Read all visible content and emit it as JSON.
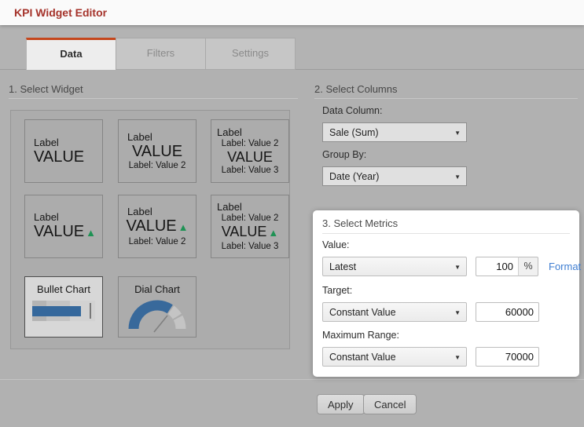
{
  "window": {
    "title": "KPI Widget Editor"
  },
  "tabs": {
    "data": "Data",
    "filters": "Filters",
    "settings": "Settings"
  },
  "icons": {
    "dropdown_arrow": "▼",
    "trend_up": "▲"
  },
  "select_widget": {
    "title": "1. Select Widget",
    "tiles": {
      "t1": {
        "label": "Label",
        "value": "VALUE"
      },
      "t2": {
        "label": "Label",
        "value": "VALUE",
        "sub": "Label: Value 2"
      },
      "t3": {
        "label": "Label",
        "sub1": "Label: Value 2",
        "value": "VALUE",
        "sub2": "Label: Value 3"
      },
      "t4": {
        "label": "Label",
        "value": "VALUE"
      },
      "t5": {
        "label": "Label",
        "value": "VALUE",
        "sub": "Label: Value 2"
      },
      "t6": {
        "label": "Label",
        "sub1": "Label: Value 2",
        "value": "VALUE",
        "sub2": "Label: Value 3"
      },
      "t7": {
        "label": "Bullet Chart"
      },
      "t8": {
        "label": "Dial Chart"
      }
    }
  },
  "select_columns": {
    "title": "2. Select Columns",
    "data_column": {
      "label": "Data Column:",
      "value": "Sale (Sum)"
    },
    "group_by": {
      "label": "Group By:",
      "value": "Date (Year)"
    }
  },
  "select_metrics": {
    "title": "3. Select Metrics",
    "value": {
      "label": "Value:",
      "method": "Latest",
      "amount": "100",
      "unit": "%",
      "format_link": "Format"
    },
    "target": {
      "label": "Target:",
      "method": "Constant Value",
      "amount": "60000"
    },
    "maximum_range": {
      "label": "Maximum Range:",
      "method": "Constant Value",
      "amount": "70000"
    }
  },
  "footer": {
    "apply": "Apply",
    "cancel": "Cancel"
  },
  "colors": {
    "title_red": "#a5332b",
    "tab_accent": "#c5471d",
    "trend_green": "#1e9254",
    "chart_blue": "#38699b",
    "link_blue": "#3f7ed2",
    "dim_background": "#b1b1b1",
    "spotlight_panel": "#ffffff"
  }
}
